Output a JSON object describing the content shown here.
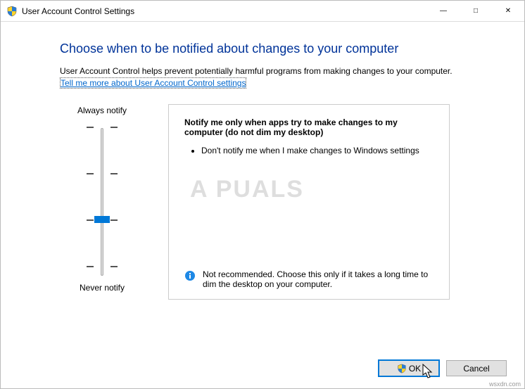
{
  "titlebar": {
    "title": "User Account Control Settings"
  },
  "heading": "Choose when to be notified about changes to your computer",
  "sub": "User Account Control helps prevent potentially harmful programs from making changes to your computer.",
  "link": "Tell me more about User Account Control settings",
  "slider": {
    "topLabel": "Always notify",
    "bottomLabel": "Never notify",
    "levels": 4,
    "selectedIndex": 2
  },
  "info": {
    "title": "Notify me only when apps try to make changes to my computer (do not dim my desktop)",
    "bullets": [
      "Don't notify me when I make changes to Windows settings"
    ],
    "recommend": "Not recommended. Choose this only if it takes a long time to dim the desktop on your computer."
  },
  "buttons": {
    "ok": "OK",
    "cancel": "Cancel"
  },
  "watermark": "A   PUALS",
  "attribution": "wsxdn.com"
}
